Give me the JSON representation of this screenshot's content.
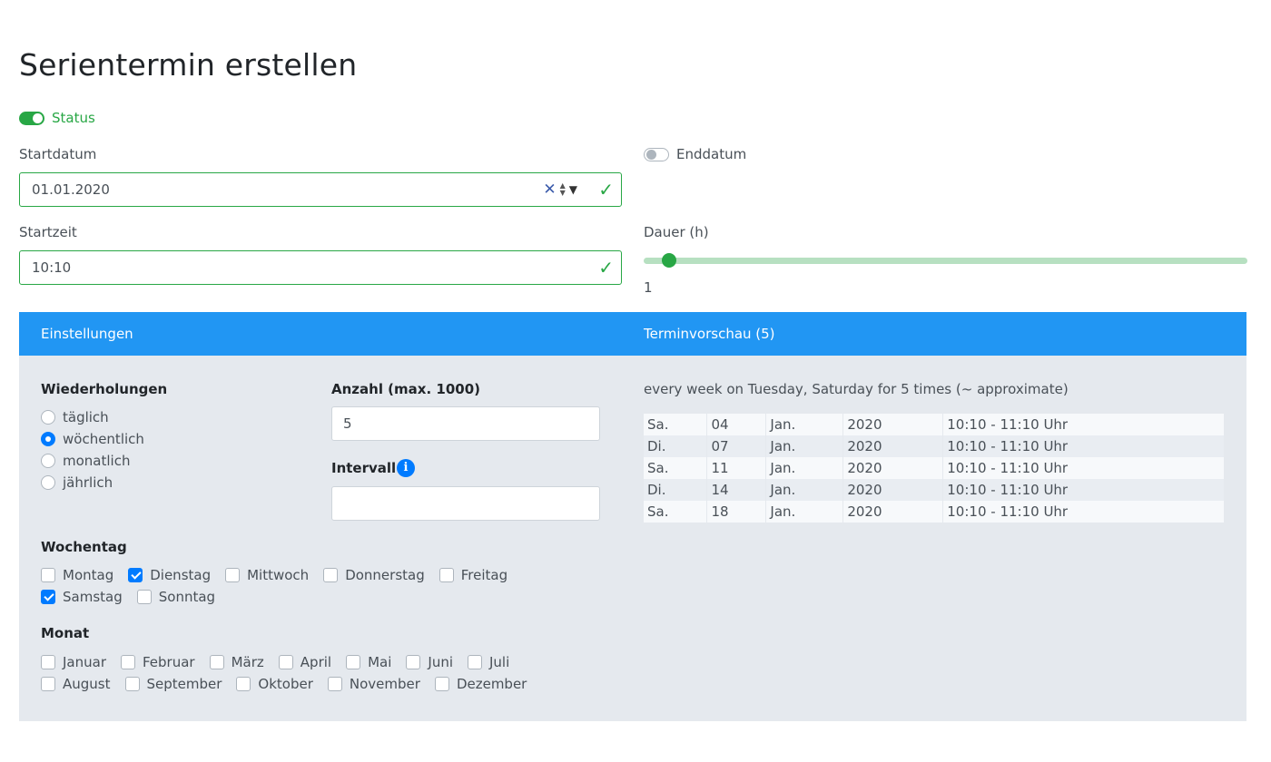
{
  "page_title": "Serientermin erstellen",
  "status": {
    "label": "Status",
    "enabled": true
  },
  "start_date": {
    "label": "Startdatum",
    "value": "01.01.2020"
  },
  "end_date": {
    "label": "Enddatum",
    "enabled": false
  },
  "start_time": {
    "label": "Startzeit",
    "value": "10:10"
  },
  "duration": {
    "label": "Dauer (h)",
    "value": "1"
  },
  "panel": {
    "settings_title": "Einstellungen",
    "preview_title": "Terminvorschau (5)"
  },
  "repetitions": {
    "label": "Wiederholungen",
    "options": [
      "täglich",
      "wöchentlich",
      "monatlich",
      "jährlich"
    ],
    "selected": "wöchentlich"
  },
  "count": {
    "label": "Anzahl (max. 1000)",
    "value": "5"
  },
  "interval": {
    "label": "Intervall",
    "value": "",
    "info_icon": "info-icon"
  },
  "weekday": {
    "label": "Wochentag",
    "items": [
      {
        "label": "Montag",
        "checked": false
      },
      {
        "label": "Dienstag",
        "checked": true
      },
      {
        "label": "Mittwoch",
        "checked": false
      },
      {
        "label": "Donnerstag",
        "checked": false
      },
      {
        "label": "Freitag",
        "checked": false
      },
      {
        "label": "Samstag",
        "checked": true
      },
      {
        "label": "Sonntag",
        "checked": false
      }
    ]
  },
  "month": {
    "label": "Monat",
    "items": [
      {
        "label": "Januar",
        "checked": false
      },
      {
        "label": "Februar",
        "checked": false
      },
      {
        "label": "März",
        "checked": false
      },
      {
        "label": "April",
        "checked": false
      },
      {
        "label": "Mai",
        "checked": false
      },
      {
        "label": "Juni",
        "checked": false
      },
      {
        "label": "Juli",
        "checked": false
      },
      {
        "label": "August",
        "checked": false
      },
      {
        "label": "September",
        "checked": false
      },
      {
        "label": "Oktober",
        "checked": false
      },
      {
        "label": "November",
        "checked": false
      },
      {
        "label": "Dezember",
        "checked": false
      }
    ]
  },
  "preview": {
    "description": "every week on Tuesday, Saturday for 5 times (~ approximate)",
    "rows": [
      [
        "Sa.",
        "04",
        "Jan.",
        "2020",
        "10:10 - 11:10 Uhr"
      ],
      [
        "Di.",
        "07",
        "Jan.",
        "2020",
        "10:10 - 11:10 Uhr"
      ],
      [
        "Sa.",
        "11",
        "Jan.",
        "2020",
        "10:10 - 11:10 Uhr"
      ],
      [
        "Di.",
        "14",
        "Jan.",
        "2020",
        "10:10 - 11:10 Uhr"
      ],
      [
        "Sa.",
        "18",
        "Jan.",
        "2020",
        "10:10 - 11:10 Uhr"
      ]
    ]
  },
  "colors": {
    "accent": "#2196f3",
    "success": "#28a745",
    "checkbox": "#007bff",
    "panel_bg": "#e5e9ee"
  }
}
